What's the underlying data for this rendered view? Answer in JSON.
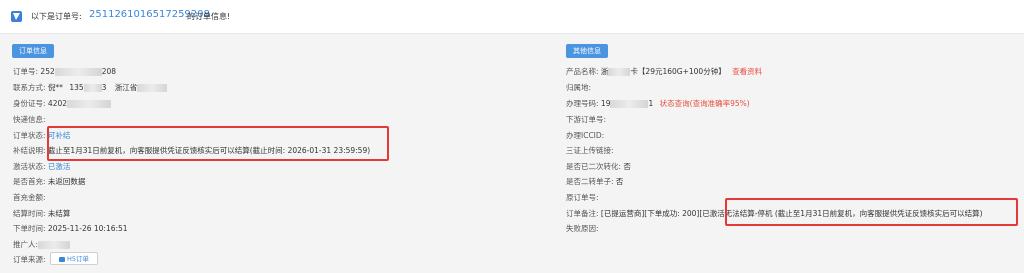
{
  "header": {
    "prefix": "以下是订单号:",
    "order_number": "2511261016517259208",
    "suffix": "的订单信息!"
  },
  "left": {
    "tab_label": "订单信息",
    "order_no": {
      "label": "订单号:",
      "v1": "252",
      "v2": "208"
    },
    "contact": {
      "label": "联系方式:",
      "name": "倪**",
      "phone_head": "135",
      "phone_tail": "3",
      "region": "浙江省"
    },
    "id_card": {
      "label": "身份证号:",
      "v1": "4202"
    },
    "express": {
      "label": "快递信息:"
    },
    "order_status": {
      "label": "订单状态:",
      "value": "可补结"
    },
    "supplement": {
      "label": "补结说明:",
      "value": "截止至1月31日前复机，向客服提供凭证反馈核实后可以结算(截止时间: 2026-01-31 23:59:59)"
    },
    "activation": {
      "label": "激活状态:",
      "value": "已激活"
    },
    "first_recharge": {
      "label": "是否首充:",
      "value": "未返回数据"
    },
    "first_amount": {
      "label": "首充金额:"
    },
    "settle_time": {
      "label": "结算时间:",
      "value": "未结算"
    },
    "order_time": {
      "label": "下单时间:",
      "value": "2025-11-26 10:16:51"
    },
    "promoter": {
      "label": "推广人:"
    },
    "source": {
      "label": "订单来源:",
      "button": "H5订单"
    }
  },
  "right": {
    "tab_label": "其他信息",
    "product": {
      "label": "产品名称:",
      "v1": "浙",
      "v2": "卡【29元160G+100分钟】",
      "link": "查看资料"
    },
    "attribution": {
      "label": "归属地:"
    },
    "handle_no": {
      "label": "办理号码:",
      "v1": "19",
      "v2": "1",
      "link": "状态查询(查询准确率95%)"
    },
    "downstream_no": {
      "label": "下游订单号:"
    },
    "iccid": {
      "label": "办理ICCID:"
    },
    "cert_upload": {
      "label": "三证上传链接:"
    },
    "second_turn": {
      "label": "是否已二次转化:",
      "value": "否"
    },
    "second_order": {
      "label": "是否二转单子:",
      "value": "否"
    },
    "orig_order": {
      "label": "原订单号:"
    },
    "remark": {
      "label": "订单备注:",
      "part1": "[已提运营商][下单成功: 200][已激活",
      "part2": "无法结算-停机 (截止至1月31日前复机，向客服提供凭证反馈核实后可以结算)"
    },
    "fail_reason": {
      "label": "失败原因:"
    }
  },
  "colors": {
    "accent": "#3a86d9",
    "highlight_box": "#e53935",
    "tab": "#4a94e0",
    "warning_link": "#e84c3d"
  }
}
